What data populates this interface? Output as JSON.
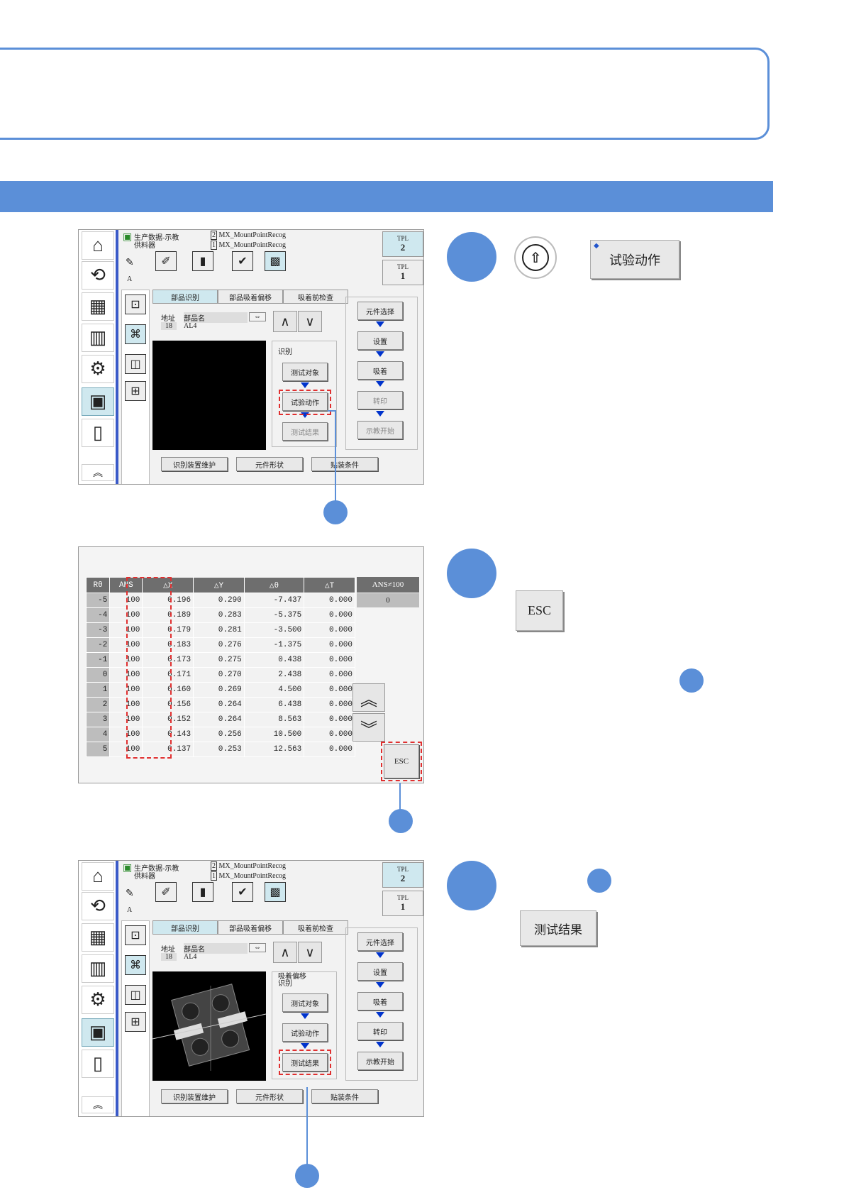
{
  "colors": {
    "accent": "#5b8fd8",
    "highlight": "#e03030",
    "screen_bg": "#f2f2f2",
    "selected": "#cfe8ef"
  },
  "screen": {
    "prod_data": "生产数据-示教",
    "feeder": "供料器",
    "recog1": "MX_MountPointRecog",
    "recog2": "MX_MountPointRecog",
    "recog1_num": "2",
    "recog2_num": "1",
    "tpl_label": "TPL",
    "tpl_top": "2",
    "tpl_bottom": "1",
    "letter_a": "A",
    "tabs": [
      "部品识别",
      "部品吸着偏移",
      "吸着前检查"
    ],
    "addr_label": "地址",
    "part_name_label": "部品名",
    "swap_icon": "⇔",
    "addr_value": "18",
    "part_value": "AL4",
    "recog_label": "识别",
    "recog_label2": "吸着偏移\n识别",
    "test_target": "测试对象",
    "trial_action": "试验动作",
    "test_result": "测试结果",
    "flow": [
      "元件选择",
      "设置",
      "吸着",
      "转印",
      "示教开始"
    ],
    "bottom": [
      "识别装置维护",
      "元件形状",
      "贴装条件"
    ]
  },
  "step1": {
    "shift_icon": "up-arrow-icon",
    "button_label": "试验动作"
  },
  "step2": {
    "esc_label": "ESC"
  },
  "step3": {
    "button_label": "测试结果"
  },
  "result_table": {
    "headers": [
      "Rθ",
      "ANS",
      "△X",
      "△Y",
      "△θ",
      "△T"
    ],
    "rows": [
      [
        "-5",
        "100",
        "0.196",
        "0.290",
        "-7.437",
        "0.000"
      ],
      [
        "-4",
        "100",
        "0.189",
        "0.283",
        "-5.375",
        "0.000"
      ],
      [
        "-3",
        "100",
        "0.179",
        "0.281",
        "-3.500",
        "0.000"
      ],
      [
        "-2",
        "100",
        "0.183",
        "0.276",
        "-1.375",
        "0.000"
      ],
      [
        "-1",
        "100",
        "0.173",
        "0.275",
        "0.438",
        "0.000"
      ],
      [
        "0",
        "100",
        "0.171",
        "0.270",
        "2.438",
        "0.000"
      ],
      [
        "1",
        "100",
        "0.160",
        "0.269",
        "4.500",
        "0.000"
      ],
      [
        "2",
        "100",
        "0.156",
        "0.264",
        "6.438",
        "0.000"
      ],
      [
        "3",
        "100",
        "0.152",
        "0.264",
        "8.563",
        "0.000"
      ],
      [
        "4",
        "100",
        "0.143",
        "0.256",
        "10.500",
        "0.000"
      ],
      [
        "5",
        "100",
        "0.137",
        "0.253",
        "12.563",
        "0.000"
      ]
    ],
    "ans_ne_header": "ANS≠100",
    "ans_ne_value": "0",
    "esc": "ESC"
  }
}
